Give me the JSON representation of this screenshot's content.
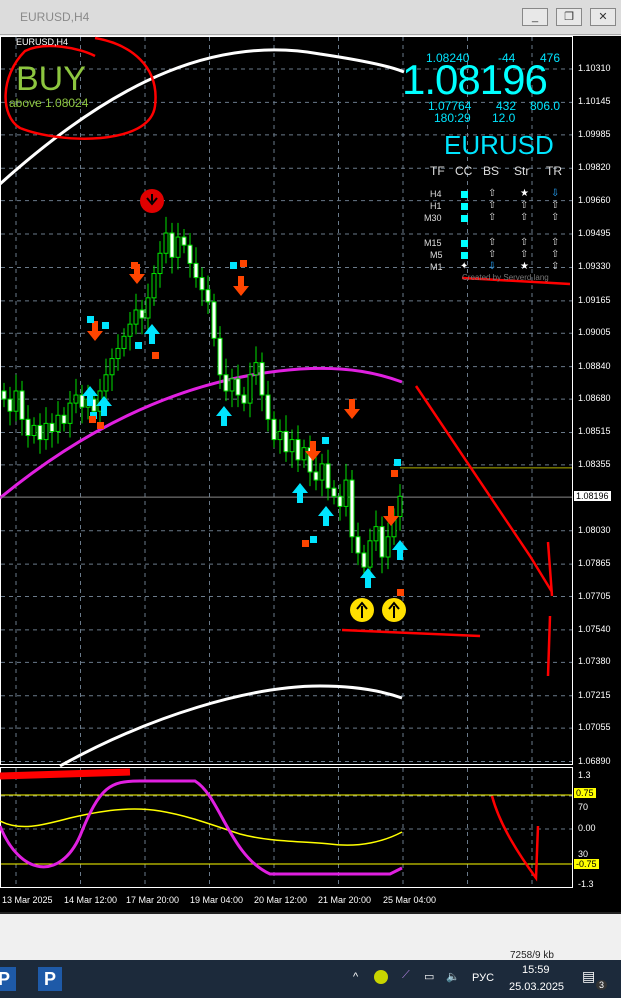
{
  "window": {
    "title": "EURUSD,H4",
    "min": "_",
    "restore": "❐",
    "close": "✕"
  },
  "chart": {
    "symbol_label": "EURUSD,H4",
    "signal": "BUY",
    "signal_sub": "above 1.08024",
    "price_axis": [
      "1.10310",
      "1.10145",
      "1.09985",
      "1.09820",
      "1.09660",
      "1.09495",
      "1.09330",
      "1.09165",
      "1.09005",
      "1.08840",
      "1.08680",
      "1.08515",
      "1.08355",
      "1.08030",
      "1.07865",
      "1.07705",
      "1.07540",
      "1.07380",
      "1.07215",
      "1.07055",
      "1.06890"
    ],
    "current_price": "1.08196",
    "time_axis": [
      "13 Mar 2025",
      "14 Mar 12:00",
      "17 Mar 20:00",
      "19 Mar 04:00",
      "20 Mar 12:00",
      "21 Mar 20:00",
      "25 Mar 04:00"
    ],
    "closes": [
      1.0868,
      1.0862,
      1.0872,
      1.0858,
      1.085,
      1.0855,
      1.0848,
      1.0856,
      1.0852,
      1.086,
      1.0856,
      1.0866,
      1.087,
      1.0864,
      1.0868,
      1.0862,
      1.0872,
      1.088,
      1.0888,
      1.0893,
      1.0899,
      1.0905,
      1.0912,
      1.0908,
      1.0918,
      1.093,
      1.094,
      1.095,
      1.0938,
      1.0948,
      1.0944,
      1.0935,
      1.0928,
      1.0922,
      1.0916,
      1.0898,
      1.088,
      1.0872,
      1.0878,
      1.087,
      1.0866,
      1.088,
      1.0886,
      1.087,
      1.0858,
      1.0848,
      1.0852,
      1.0842,
      1.0848,
      1.0838,
      1.0844,
      1.0832,
      1.0828,
      1.0836,
      1.0824,
      1.082,
      1.0815,
      1.0828,
      1.08,
      1.0792,
      1.0785,
      1.0798,
      1.0805,
      1.079,
      1.08,
      1.081,
      1.082
    ]
  },
  "info": {
    "high": "1.08240",
    "chg": "-44",
    "v1": "476",
    "price": "1.08196",
    "low": "1.07764",
    "v2": "432",
    "v3": "806.0",
    "timer": "180:29",
    "v4": "12.0",
    "pair": "EURUSD",
    "headers": [
      "TF",
      "CC",
      "BS",
      "Str",
      "TR"
    ],
    "rows": [
      {
        "tf": "H4",
        "bs": "⇧",
        "str": "★",
        "tr": "⇩"
      },
      {
        "tf": "H1",
        "bs": "⇧",
        "str": "⇧",
        "tr": "⇧"
      },
      {
        "tf": "M30",
        "bs": "⇧",
        "str": "⇧",
        "tr": "⇧"
      },
      {
        "tf": "M15",
        "bs": "⇧",
        "str": "⇧",
        "tr": "⇧"
      },
      {
        "tf": "M5",
        "bs": "⇧",
        "str": "⇧",
        "tr": "⇧"
      },
      {
        "tf": "M1",
        "bs": "⇩",
        "str": "★",
        "tr": "⇧"
      }
    ],
    "credit": "Created by Serverd lang"
  },
  "indicator": {
    "axis": [
      "1.3",
      "70",
      "0.00",
      "30",
      "-1.3"
    ],
    "levels": [
      "0.75",
      "-0.75"
    ]
  },
  "status": {
    "traffic": "7258/9 kb"
  },
  "taskbar": {
    "lang": "РУС",
    "time": "15:59",
    "date": "25.03.2025",
    "notif": "3"
  }
}
